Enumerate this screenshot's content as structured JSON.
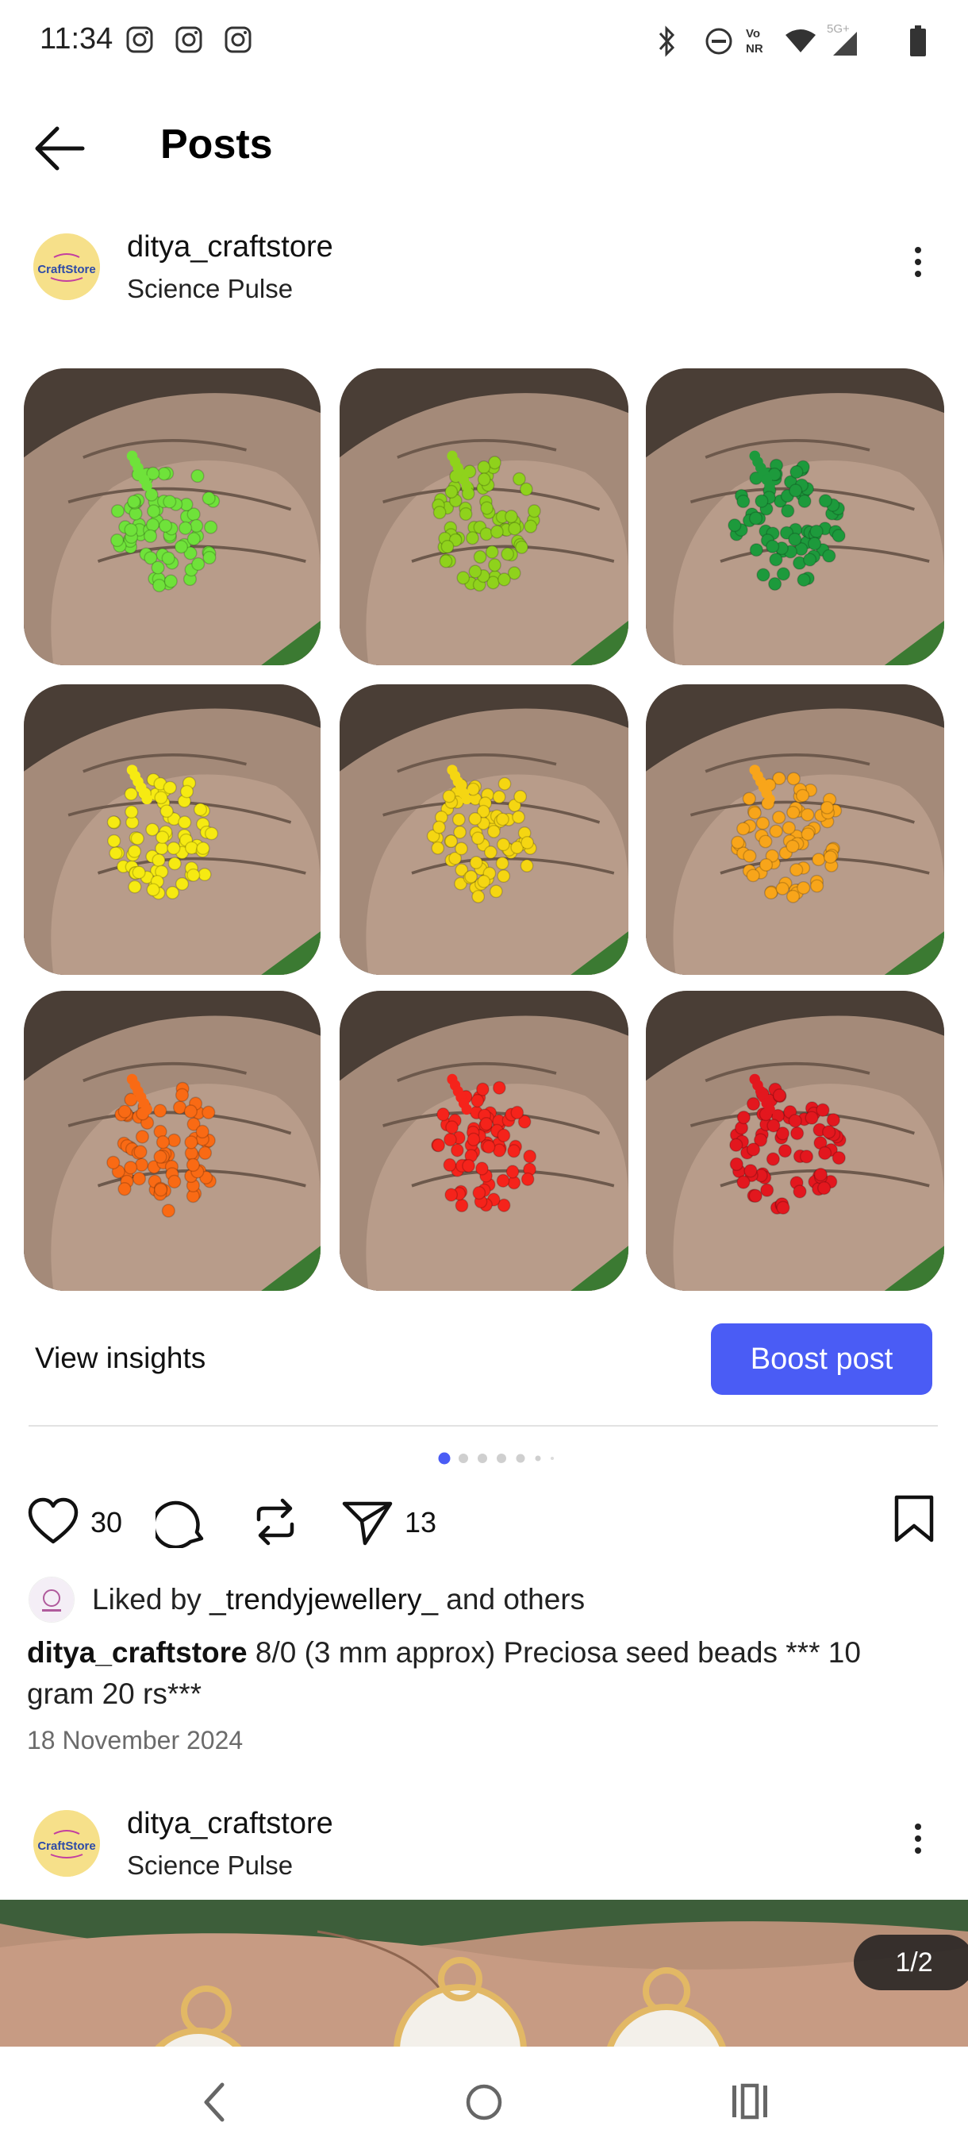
{
  "status_bar": {
    "time": "11:34"
  },
  "header": {
    "title": "Posts"
  },
  "post1": {
    "username": "ditya_craftstore",
    "subtitle": "Science Pulse",
    "avatar_text": "CraftStore",
    "images": [
      {
        "bead_color": "#6fe23a"
      },
      {
        "bead_color": "#8fd21c"
      },
      {
        "bead_color": "#1d9a3c"
      },
      {
        "bead_color": "#f6ea12"
      },
      {
        "bead_color": "#f5d612"
      },
      {
        "bead_color": "#f8a51a"
      },
      {
        "bead_color": "#f96a14"
      },
      {
        "bead_color": "#f5231b"
      },
      {
        "bead_color": "#e3171e"
      }
    ],
    "view_insights_label": "View insights",
    "boost_label": "Boost post",
    "likes_count": "30",
    "shares_count": "13",
    "liked_by_prefix": "Liked by ",
    "liked_by_user": "_trendyjewellery_",
    "liked_by_suffix": " and others",
    "caption_user": "ditya_craftstore",
    "caption_text": " 8/0 (3 mm approx) Preciosa seed beads *** 10 gram 20 rs***",
    "date": "18 November 2024"
  },
  "post2": {
    "username": "ditya_craftstore",
    "subtitle": "Science Pulse",
    "avatar_text": "CraftStore",
    "page_indicator": "1/2"
  },
  "colors": {
    "accent": "#4a5cf5",
    "carousel_active": "#4a5cf5"
  }
}
